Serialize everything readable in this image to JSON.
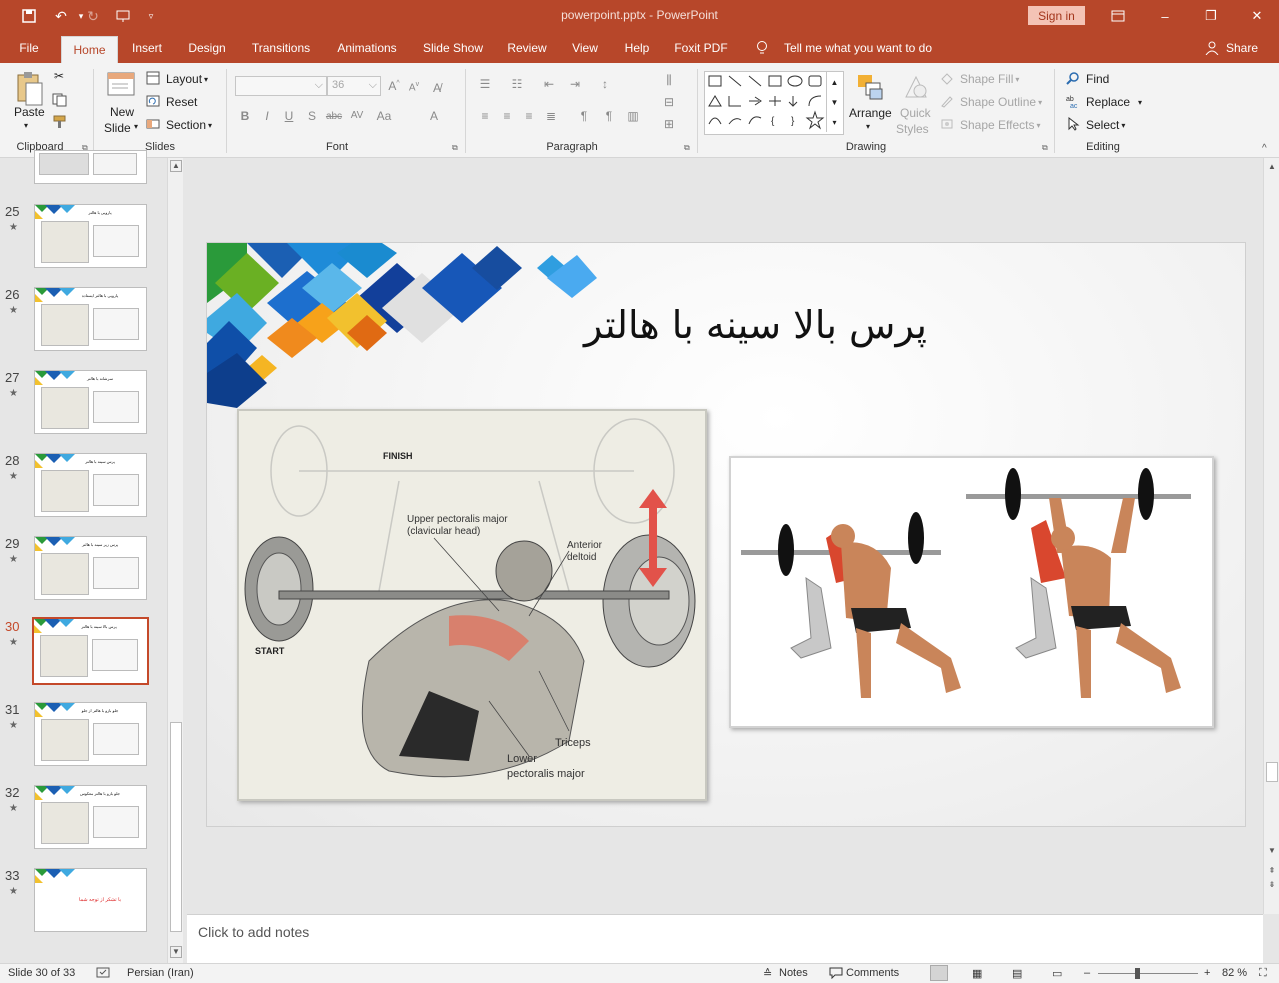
{
  "app": {
    "doc_title": "powerpoint.pptx  -  PowerPoint",
    "signin_label": "Sign in"
  },
  "tabs": [
    "File",
    "Home",
    "Insert",
    "Design",
    "Transitions",
    "Animations",
    "Slide Show",
    "Review",
    "View",
    "Help",
    "Foxit PDF"
  ],
  "tell_me": "Tell me what you want to do",
  "share_label": "Share",
  "ribbon": {
    "clipboard": {
      "label": "Clipboard",
      "paste": "Paste"
    },
    "slides": {
      "label": "Slides",
      "new_slide": "New",
      "new_slide2": "Slide",
      "layout": "Layout",
      "reset": "Reset",
      "section": "Section"
    },
    "font": {
      "label": "Font",
      "size": "36"
    },
    "paragraph": {
      "label": "Paragraph"
    },
    "drawing": {
      "label": "Drawing",
      "arrange": "Arrange",
      "quick_styles": "Quick",
      "quick_styles2": "Styles",
      "shape_fill": "Shape Fill",
      "shape_outline": "Shape Outline",
      "shape_effects": "Shape Effects"
    },
    "editing": {
      "label": "Editing",
      "find": "Find",
      "replace": "Replace",
      "select": "Select"
    }
  },
  "thumbnails": [
    {
      "num": "25",
      "title": "پارویی با هالتر"
    },
    {
      "num": "26",
      "title": "پارویی با هالتر ایستاده"
    },
    {
      "num": "27",
      "title": "سرشانه با هالتر"
    },
    {
      "num": "28",
      "title": "پرس سینه با هالتر"
    },
    {
      "num": "29",
      "title": "پرس زیر سینه با هالتر"
    },
    {
      "num": "30",
      "title": "پرس بالا سینه با هالتر"
    },
    {
      "num": "31",
      "title": "جلو بازو با هالتر از جلو"
    },
    {
      "num": "32",
      "title": "جلو بازو با هالتر معکوس"
    },
    {
      "num": "33",
      "title": "با تشکر از توجه شما"
    }
  ],
  "slide": {
    "title": "پرس بالا سینه با هالتر",
    "fig_labels": {
      "finish": "FINISH",
      "start": "START",
      "upper_pec": "Upper pectoralis major",
      "upper_pec2": "(clavicular head)",
      "anterior": "Anterior",
      "deltoid": "deltoid",
      "triceps": "Triceps",
      "lower": "Lower",
      "lower_pec": "pectoralis major"
    }
  },
  "notes_placeholder": "Click to add notes",
  "status": {
    "slide_info": "Slide 30 of 33",
    "language": "Persian (Iran)",
    "notes": "Notes",
    "comments": "Comments",
    "zoom": "82 %"
  },
  "colors": {
    "accent": "#b7472a",
    "selected_thumb": "#c4492a"
  }
}
